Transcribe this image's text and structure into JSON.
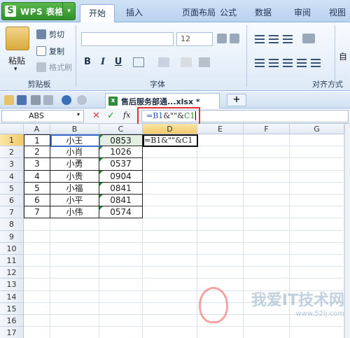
{
  "app": {
    "wps_title": "WPS 表格",
    "wps_logo": "S",
    "wps_dropdown": "▾"
  },
  "tabs": [
    "开始",
    "插入",
    "页面布局",
    "公式",
    "数据",
    "审阅",
    "视图"
  ],
  "ribbon": {
    "paste_label": "粘贴",
    "paste_dropdown": "▾",
    "cut_label": "剪切",
    "copy_label": "复制",
    "format_painter_label": "格式刷",
    "clipboard_group": "剪贴板",
    "font_size": "12",
    "bold": "B",
    "italic": "I",
    "underline": "U",
    "font_group": "字体",
    "align_group": "对齐方式",
    "auto_label": "自"
  },
  "doc_tab": {
    "filename": "售后服务部通...xlsx *",
    "xls_icon": "x",
    "add_tab": "+"
  },
  "formula_bar": {
    "name_box": "ABS",
    "cancel": "✕",
    "confirm": "✓",
    "fx": "fx",
    "formula_b1": "=B1",
    "formula_amp1": "&",
    "formula_quotes": "\"\"",
    "formula_amp2": "&",
    "formula_c1": "C1"
  },
  "columns": [
    "A",
    "B",
    "C",
    "D",
    "E",
    "F",
    "G"
  ],
  "rows": [
    "1",
    "2",
    "3",
    "4",
    "5",
    "6",
    "7",
    "8",
    "9",
    "10",
    "11",
    "12",
    "13",
    "14",
    "15",
    "16",
    "17"
  ],
  "cells": {
    "A": [
      "1",
      "2",
      "3",
      "4",
      "5",
      "6",
      "7"
    ],
    "B": [
      "小王",
      "小肖",
      "小勇",
      "小贵",
      "小福",
      "小平",
      "小伟"
    ],
    "C": [
      "0853",
      "1026",
      "0537",
      "0904",
      "0841",
      "0841",
      "0574"
    ],
    "D1": "=B1&\"\"&C1"
  },
  "colors": {
    "accent_green": "#2f8f2a",
    "highlight_red": "#e53030",
    "selection_blue": "#3b6ec9"
  },
  "watermark": {
    "main": "我爱IT技术网",
    "sub": "www.52ij.com"
  }
}
